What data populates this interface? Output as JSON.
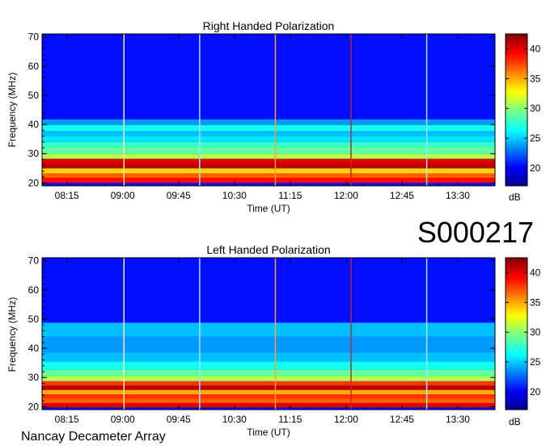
{
  "observation_id": "S000217",
  "footer_label": "Nancay Decameter Array",
  "chart_data": [
    {
      "type": "heatmap",
      "title": "Right Handed Polarization",
      "xlabel": "Time (UT)",
      "ylabel": "Frequency (MHz)",
      "x_tick_labels": [
        "08:15",
        "09:00",
        "09:45",
        "10:30",
        "11:15",
        "12:00",
        "12:45",
        "13:30"
      ],
      "x_tick_minutes": [
        495,
        540,
        585,
        630,
        675,
        720,
        765,
        810
      ],
      "xlim_minutes": [
        475,
        840
      ],
      "y_ticks": [
        20,
        30,
        40,
        50,
        60,
        70
      ],
      "ylim": [
        19,
        71
      ],
      "colorbar": {
        "label": "dB",
        "ticks": [
          20,
          25,
          30,
          35,
          40
        ],
        "range": [
          17,
          42.5
        ]
      },
      "grid": false,
      "vertical_lines": [
        {
          "time_minutes": 541,
          "color": "#ffe8b0"
        },
        {
          "time_minutes": 602,
          "color": "#9fe0ff"
        },
        {
          "time_minutes": 663,
          "color": "#ff9c3c"
        },
        {
          "time_minutes": 724,
          "color": "#c8281a"
        },
        {
          "time_minutes": 785,
          "color": "#9feaff"
        }
      ],
      "emission_bands": [
        {
          "freq_mhz": 21,
          "db": 39
        },
        {
          "freq_mhz": 22.5,
          "db": 37
        },
        {
          "freq_mhz": 24,
          "db": 34
        },
        {
          "freq_mhz": 26,
          "db": 41
        },
        {
          "freq_mhz": 27.5,
          "db": 40
        },
        {
          "freq_mhz": 29,
          "db": 31
        },
        {
          "freq_mhz": 31,
          "db": 29
        },
        {
          "freq_mhz": 33,
          "db": 28
        },
        {
          "freq_mhz": 35,
          "db": 26
        },
        {
          "freq_mhz": 37,
          "db": 25
        },
        {
          "freq_mhz": 38.5,
          "db": 27
        },
        {
          "freq_mhz": 41,
          "db": 24
        }
      ]
    },
    {
      "type": "heatmap",
      "title": "Left Handed Polarization",
      "xlabel": "Time (UT)",
      "ylabel": "Frequency (MHz)",
      "x_tick_labels": [
        "08:15",
        "09:00",
        "09:45",
        "10:30",
        "11:15",
        "12:00",
        "12:45",
        "13:30"
      ],
      "x_tick_minutes": [
        495,
        540,
        585,
        630,
        675,
        720,
        765,
        810
      ],
      "xlim_minutes": [
        475,
        840
      ],
      "y_ticks": [
        20,
        30,
        40,
        50,
        60,
        70
      ],
      "ylim": [
        19,
        71
      ],
      "colorbar": {
        "label": "dB",
        "ticks": [
          20,
          25,
          30,
          35,
          40
        ],
        "range": [
          17,
          42.5
        ]
      },
      "grid": false,
      "vertical_lines": [
        {
          "time_minutes": 541,
          "color": "#ffe8b0"
        },
        {
          "time_minutes": 602,
          "color": "#9fe0ff"
        },
        {
          "time_minutes": 663,
          "color": "#ff9c3c"
        },
        {
          "time_minutes": 724,
          "color": "#c8281a"
        },
        {
          "time_minutes": 785,
          "color": "#9feaff"
        }
      ],
      "emission_bands": [
        {
          "freq_mhz": 20.5,
          "db": 40
        },
        {
          "freq_mhz": 22,
          "db": 37
        },
        {
          "freq_mhz": 23.5,
          "db": 38
        },
        {
          "freq_mhz": 25,
          "db": 35
        },
        {
          "freq_mhz": 26.5,
          "db": 41
        },
        {
          "freq_mhz": 28,
          "db": 38
        },
        {
          "freq_mhz": 29.5,
          "db": 31
        },
        {
          "freq_mhz": 31.5,
          "db": 29
        },
        {
          "freq_mhz": 34,
          "db": 27
        },
        {
          "freq_mhz": 37,
          "db": 25
        },
        {
          "freq_mhz": 40,
          "db": 24
        },
        {
          "freq_mhz": 48,
          "db": 25
        }
      ]
    }
  ]
}
